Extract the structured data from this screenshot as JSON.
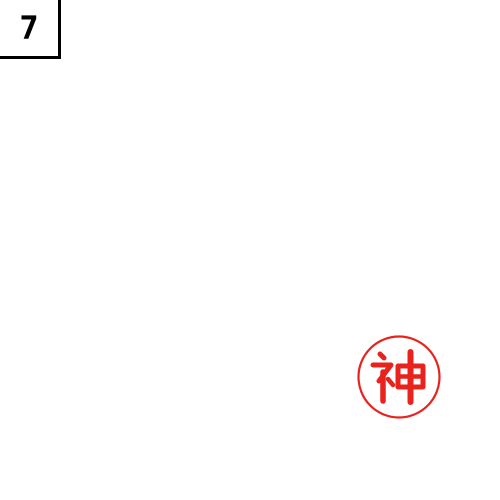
{
  "page_number": "7",
  "seal": {
    "text": "神",
    "icon": "hanko-seal-icon",
    "color": "#e8231e"
  }
}
